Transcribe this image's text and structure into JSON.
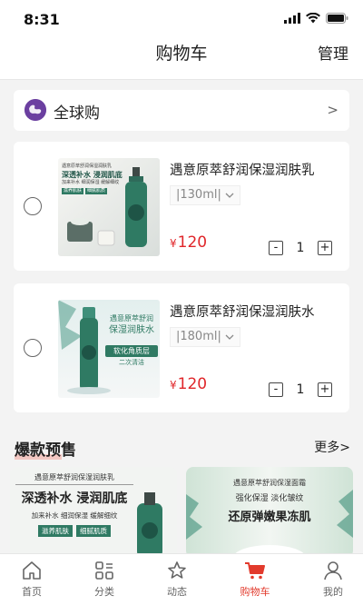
{
  "status_bar": {
    "time": "8:31"
  },
  "header": {
    "title": "购物车",
    "manage": "管理"
  },
  "global_buy": {
    "label": "全球购",
    "arrow": ">"
  },
  "cart_items": [
    {
      "name": "遇意原萃舒润保湿润肤乳",
      "spec": "|130ml|",
      "currency": "¥",
      "price": "120",
      "quantity": "1",
      "image_text": {
        "line1": "遇意原萃舒润保湿润肤乳",
        "line2": "深透补水 浸润肌底",
        "line3": "加来补水 细润保湿 缓解细纹",
        "tag1": "滋养肌肤",
        "tag2": "细腻肌质"
      }
    },
    {
      "name": "遇意原萃舒润保湿润肤水",
      "spec": "|180ml|",
      "currency": "¥",
      "price": "120",
      "quantity": "1",
      "image_text": {
        "line1": "遇意原萃舒润",
        "line2": "保湿润肤水",
        "line3": "软化角质层",
        "line4": "二次清洁"
      }
    }
  ],
  "hot_presale": {
    "title": "爆款预售",
    "more": "更多>",
    "banners": [
      {
        "line1": "遇意原萃舒润保湿润肤乳",
        "line2": "深透补水 浸润肌底",
        "line3": "加来补水 细润保湿 缓解细纹",
        "tag1": "滋养肌肤",
        "tag2": "细腻肌质"
      },
      {
        "line1": "遇意原萃舒润保湿面霜",
        "line2": "强化保湿 淡化皱纹",
        "line3": "还原弹嫩果冻肌"
      }
    ]
  },
  "tab_bar": [
    {
      "label": "首页",
      "icon": "home-icon"
    },
    {
      "label": "分类",
      "icon": "category-icon"
    },
    {
      "label": "动态",
      "icon": "star-icon"
    },
    {
      "label": "购物车",
      "icon": "cart-icon",
      "active": true
    },
    {
      "label": "我的",
      "icon": "user-icon"
    }
  ],
  "colors": {
    "accent": "#e23a2c",
    "price": "#e0262a",
    "brand_purple": "#6b3fa0"
  }
}
